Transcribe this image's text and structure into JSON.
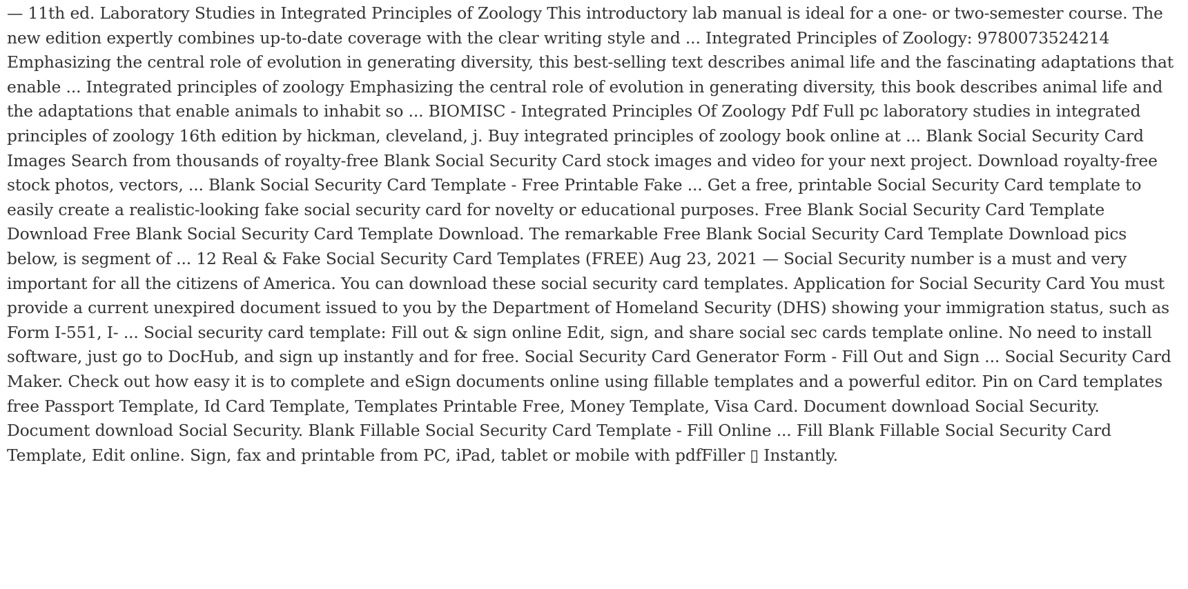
{
  "document": {
    "body_text": "— 11th ed. Laboratory Studies in Integrated Principles of Zoology This introductory lab manual is ideal for a one- or two-semester course. The new edition expertly combines up-to-date coverage with the clear writing style and ... Integrated Principles of Zoology: 9780073524214 Emphasizing the central role of evolution in generating diversity, this best-selling text describes animal life and the fascinating adaptations that enable ... Integrated principles of zoology Emphasizing the central role of evolution in generating diversity, this book describes animal life and the adaptations that enable animals to inhabit so ... BIOMISC - Integrated Principles Of Zoology Pdf Full pc laboratory studies in integrated principles of zoology 16th edition by hickman, cleveland, j. Buy integrated principles of zoology book online at ... Blank Social Security Card Images Search from thousands of royalty-free Blank Social Security Card stock images and video for your next project. Download royalty-free stock photos, vectors, ... Blank Social Security Card Template - Free Printable Fake ... Get a free, printable Social Security Card template to easily create a realistic-looking fake social security card for novelty or educational purposes. Free Blank Social Security Card Template Download Free Blank Social Security Card Template Download. The remarkable Free Blank Social Security Card Template Download pics below, is segment of ... 12 Real & Fake Social Security Card Templates (FREE) Aug 23, 2021 — Social Security number is a must and very important for all the citizens of America. You can download these social security card templates. Application for Social Security Card You must provide a current unexpired document issued to you by the Department of Homeland Security (DHS) showing your immigration status, such as Form I-551, I- ... Social security card template: Fill out & sign online Edit, sign, and share social sec cards template online. No need to install software, just go to DocHub, and sign up instantly and for free. Social Security Card Generator Form - Fill Out and Sign ... Social Security Card Maker. Check out how easy it is to complete and eSign documents online using fillable templates and a powerful editor. Pin on Card templates free Passport Template, Id Card Template, Templates Printable Free, Money Template, Visa Card. Document download Social Security. Document download Social Security. Blank Fillable Social Security Card Template - Fill Online ... Fill Blank Fillable Social Security Card Template, Edit online. Sign, fax and printable from PC, iPad, tablet or mobile with pdfFiller ▯ Instantly."
  }
}
